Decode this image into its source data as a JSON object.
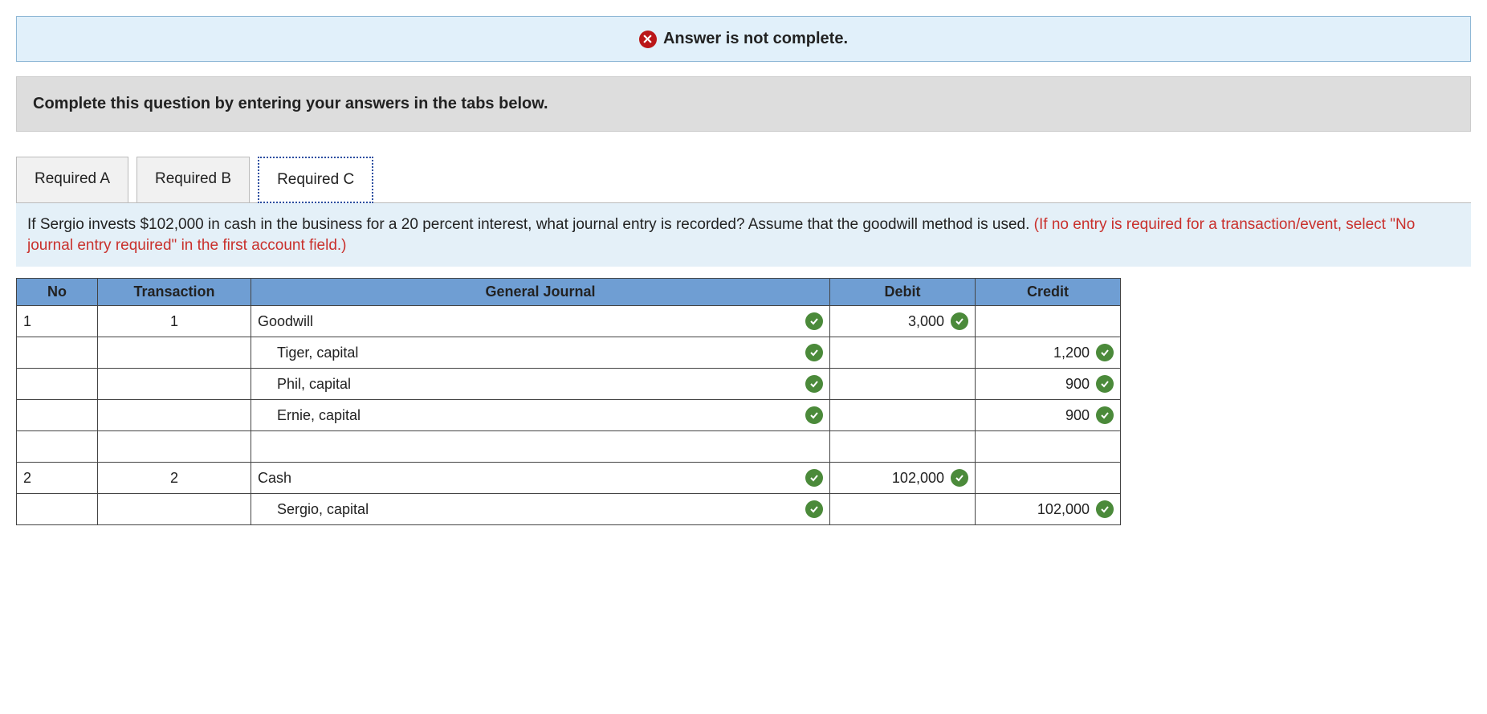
{
  "status": {
    "text": "Answer is not complete."
  },
  "instruction": "Complete this question by entering your answers in the tabs below.",
  "tabs": [
    {
      "label": "Required A"
    },
    {
      "label": "Required B"
    },
    {
      "label": "Required C"
    }
  ],
  "question": {
    "body": "If Sergio invests $102,000 in cash in the business for a 20 percent interest, what journal entry is recorded? Assume that the goodwill method is used. ",
    "note": "(If no entry is required for a transaction/event, select \"No journal entry required\" in the first account field.)"
  },
  "headers": {
    "no": "No",
    "transaction": "Transaction",
    "journal": "General Journal",
    "debit": "Debit",
    "credit": "Credit"
  },
  "rows": [
    {
      "no": "1",
      "trans": "1",
      "account": "Goodwill",
      "indent": false,
      "acct_ok": true,
      "debit": "3,000",
      "debit_ok": true,
      "credit": "",
      "credit_ok": false
    },
    {
      "no": "",
      "trans": "",
      "account": "Tiger, capital",
      "indent": true,
      "acct_ok": true,
      "debit": "",
      "debit_ok": false,
      "credit": "1,200",
      "credit_ok": true
    },
    {
      "no": "",
      "trans": "",
      "account": "Phil, capital",
      "indent": true,
      "acct_ok": true,
      "debit": "",
      "debit_ok": false,
      "credit": "900",
      "credit_ok": true
    },
    {
      "no": "",
      "trans": "",
      "account": "Ernie, capital",
      "indent": true,
      "acct_ok": true,
      "debit": "",
      "debit_ok": false,
      "credit": "900",
      "credit_ok": true
    },
    {
      "no": "",
      "trans": "",
      "account": "",
      "indent": false,
      "acct_ok": false,
      "debit": "",
      "debit_ok": false,
      "credit": "",
      "credit_ok": false
    },
    {
      "no": "2",
      "trans": "2",
      "account": "Cash",
      "indent": false,
      "acct_ok": true,
      "debit": "102,000",
      "debit_ok": true,
      "credit": "",
      "credit_ok": false
    },
    {
      "no": "",
      "trans": "",
      "account": "Sergio, capital",
      "indent": true,
      "acct_ok": true,
      "debit": "",
      "debit_ok": false,
      "credit": "102,000",
      "credit_ok": true
    }
  ]
}
